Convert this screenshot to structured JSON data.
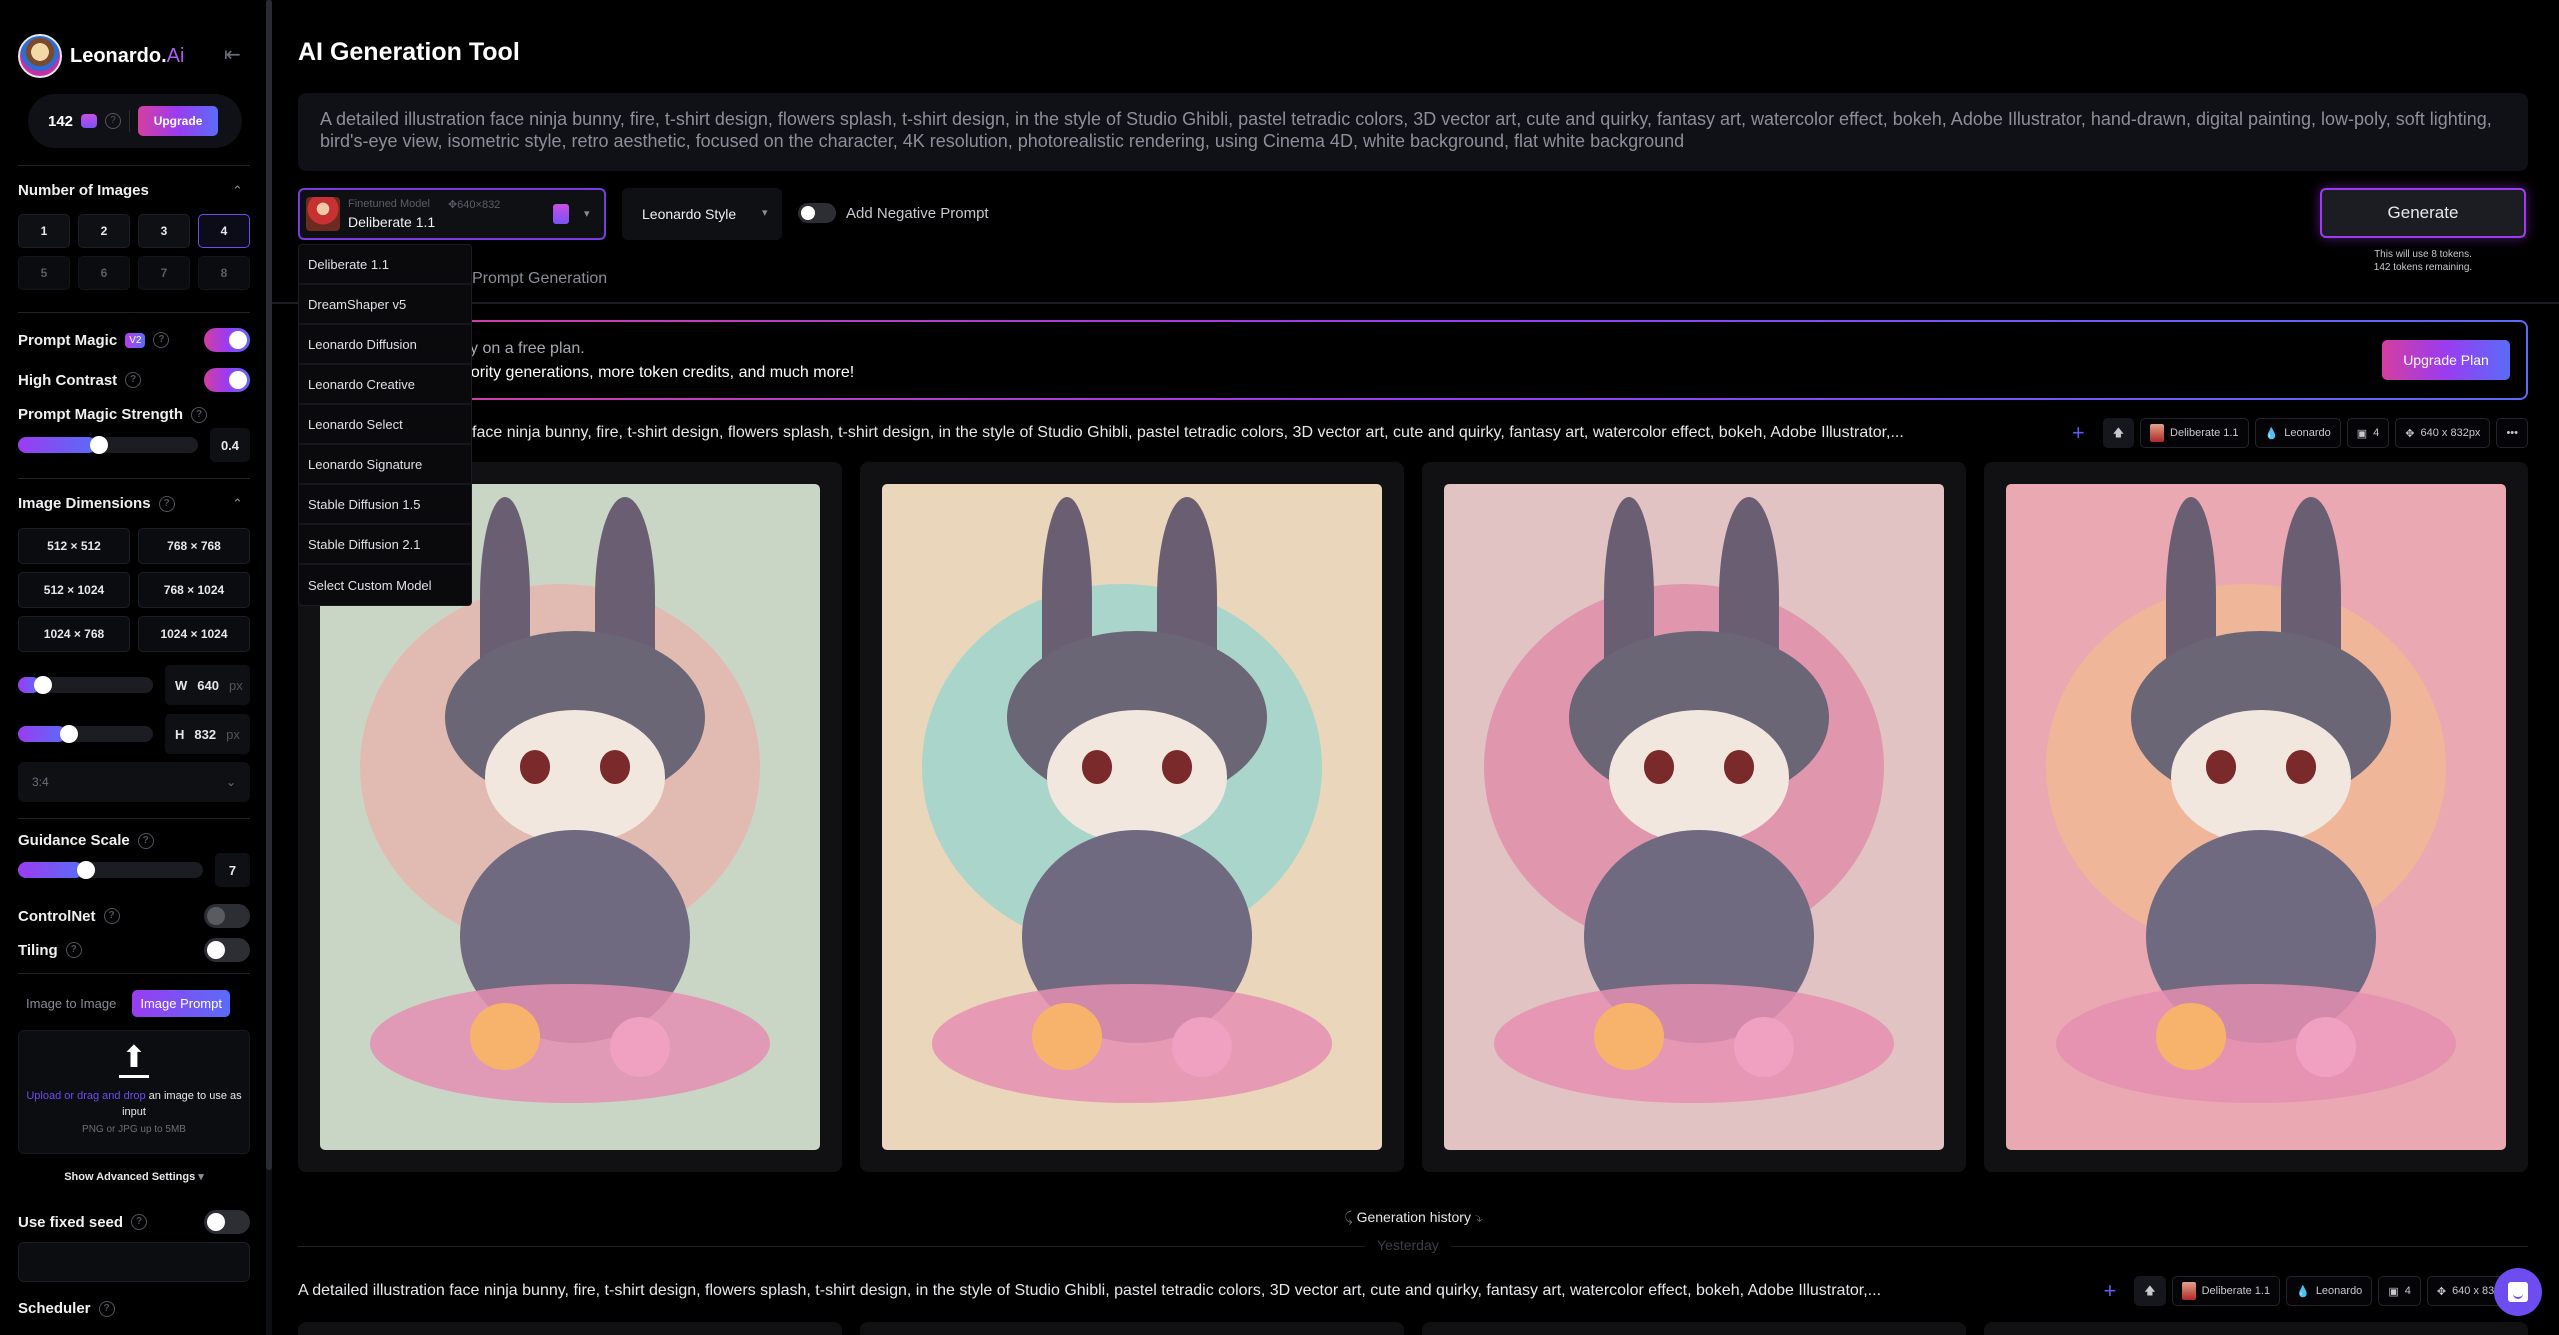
{
  "sidebar": {
    "brand_main": "Leonardo.",
    "brand_ai": "Ai",
    "tokens": "142",
    "upgrade_label": "Upgrade",
    "num_images": {
      "title": "Number of Images",
      "options": [
        "1",
        "2",
        "3",
        "4",
        "5",
        "6",
        "7",
        "8"
      ],
      "selected": "4"
    },
    "prompt_magic": {
      "label": "Prompt Magic",
      "badge": "V2",
      "on": true
    },
    "high_contrast": {
      "label": "High Contrast",
      "on": true
    },
    "pm_strength": {
      "label": "Prompt Magic Strength",
      "value": "0.4",
      "fraction": 0.4
    },
    "dimensions": {
      "title": "Image Dimensions",
      "presets": [
        "512 × 512",
        "768 × 768",
        "512 × 1024",
        "768 × 1024",
        "1024 × 768",
        "1024 × 1024"
      ],
      "w_label": "W",
      "w_value": "640",
      "h_label": "H",
      "h_value": "832",
      "unit": "px",
      "w_fraction": 0.12,
      "h_fraction": 0.31,
      "ratio": "3:4"
    },
    "guidance": {
      "label": "Guidance Scale",
      "value": "7",
      "fraction": 0.32
    },
    "controlnet": {
      "label": "ControlNet",
      "on": false
    },
    "tiling": {
      "label": "Tiling",
      "on": false
    },
    "image_tabs": [
      "Image to Image",
      "Image Prompt"
    ],
    "dropzone": {
      "link": "Upload or drag and drop",
      "text": " an image to use as input",
      "sub": "PNG or JPG up to 5MB"
    },
    "advanced": "Show Advanced Settings",
    "fixed_seed": {
      "label": "Use fixed seed",
      "on": false,
      "value": ""
    },
    "scheduler": {
      "label": "Scheduler"
    }
  },
  "main": {
    "title": "AI Generation Tool",
    "prompt": "A detailed illustration face ninja bunny, fire, t-shirt design, flowers splash, t-shirt design, in the style of Studio Ghibli, pastel tetradic colors, 3D vector art, cute and quirky, fantasy art, watercolor effect, bokeh, Adobe Illustrator, hand-drawn, digital painting, low-poly, soft lighting, bird's-eye view, isometric style, retro aesthetic, focused on the character, 4K resolution, photorealistic rendering, using Cinema 4D, white background, flat white background",
    "model": {
      "caption": "Finetuned Model",
      "dims": "✥640×832",
      "name": "Deliberate 1.1"
    },
    "style": "Leonardo Style",
    "negative_prompt": "Add Negative Prompt",
    "generate": "Generate",
    "gen_note_1": "This will use 8 tokens.",
    "gen_note_2": "142 tokens remaining.",
    "tab_visible": "Prompt Generation",
    "banner_l1": "tly on a free plan.",
    "banner_l2": "riority generations, more token credits, and much more!",
    "upgrade_plan": "Upgrade Plan",
    "model_options": [
      "Deliberate 1.1",
      "DreamShaper v5",
      "Leonardo Diffusion",
      "Leonardo Creative",
      "Leonardo Select",
      "Leonardo Signature",
      "Stable Diffusion 1.5",
      "Stable Diffusion 2.1",
      "Select Custom Model"
    ],
    "gen1_prompt": "face ninja bunny, fire, t-shirt design, flowers splash, t-shirt design, in the style of Studio Ghibli, pastel tetradic colors, 3D vector art, cute and quirky, fantasy art, watercolor effect, bokeh, Adobe Illustrator,...",
    "gen2_prompt": "A detailed illustration face ninja bunny, fire, t-shirt design, flowers splash, t-shirt design, in the style of Studio Ghibli, pastel tetradic colors, 3D vector art, cute and quirky, fantasy art, watercolor effect, bokeh, Adobe Illustrator,...",
    "chips": {
      "model": "Deliberate 1.1",
      "style": "Leonardo",
      "count": "4",
      "size": "640 x 832px",
      "more": "•••"
    },
    "images": [
      {
        "alt": "ninja bunny with grey hood and flowers",
        "bg": "#c9d6c6",
        "blob": "#f1a9a4"
      },
      {
        "alt": "ninja bunny with blue scarf and flowers",
        "bg": "#e9d6bb",
        "blob": "#7fd3d6"
      },
      {
        "alt": "ninja bunny surrounded by pink blossoms",
        "bg": "#e1c3c3",
        "blob": "#e07aa0"
      },
      {
        "alt": "ninja bunny in hooded cloak with hexagons",
        "bg": "#e9a8b2",
        "blob": "#f3c089"
      }
    ],
    "history": "Generation history",
    "yesterday": "Yesterday"
  }
}
